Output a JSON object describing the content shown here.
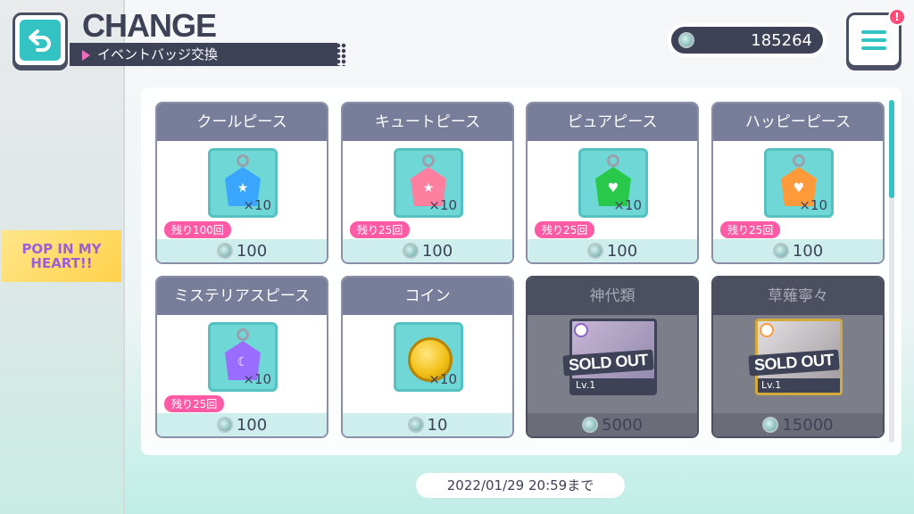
{
  "header": {
    "title": "CHANGE",
    "subtitle": "イベントバッジ交換"
  },
  "currency": {
    "amount": "185264",
    "icon": "event-badge-icon"
  },
  "menu": {
    "notification": "!"
  },
  "event_banner": {
    "text": "POP IN MY HEART!!"
  },
  "cards": [
    {
      "title": "クールピース",
      "qty": "×10",
      "remain": "残り100回",
      "cost": "100",
      "gem_color": "#3aa6ff",
      "symbol": "★"
    },
    {
      "title": "キュートピース",
      "qty": "×10",
      "remain": "残り25回",
      "cost": "100",
      "gem_color": "#ff7fa0",
      "symbol": "★"
    },
    {
      "title": "ピュアピース",
      "qty": "×10",
      "remain": "残り25回",
      "cost": "100",
      "gem_color": "#28c84a",
      "symbol": "♥"
    },
    {
      "title": "ハッピーピース",
      "qty": "×10",
      "remain": "残り25回",
      "cost": "100",
      "gem_color": "#ff9a3a",
      "symbol": "♥"
    },
    {
      "title": "ミステリアスピース",
      "qty": "×10",
      "remain": "残り25回",
      "cost": "100",
      "gem_color": "#9a6cff",
      "symbol": "☾"
    },
    {
      "title": "コイン",
      "qty": "×10",
      "cost": "10"
    },
    {
      "title": "神代類",
      "status": "SOLD OUT",
      "level": "Lv.1",
      "cost": "5000"
    },
    {
      "title": "草薙寧々",
      "status": "SOLD OUT",
      "level": "Lv.1",
      "cost": "15000"
    }
  ],
  "deadline": "2022/01/29 20:59まで"
}
